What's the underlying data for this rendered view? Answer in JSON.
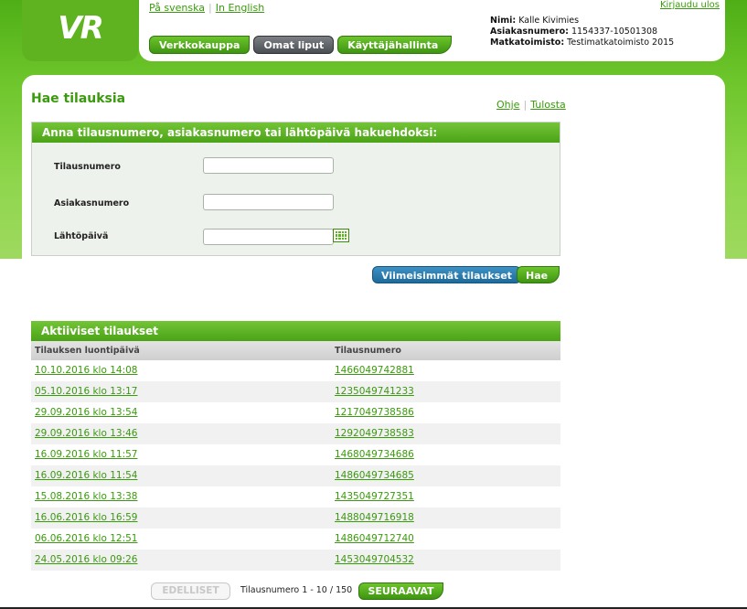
{
  "brand": {
    "logo": "VR",
    "accent": "#4fae16"
  },
  "header": {
    "lang_sv": "På svenska",
    "lang_en": "In English",
    "logout": "Kirjaudu ulos",
    "user": {
      "name_label": "Nimi:",
      "name": "Kalle Kivimies",
      "customer_label": "Asiakasnumero:",
      "customer": "1154337-10501308",
      "office_label": "Matkatoimisto:",
      "office": "Testimatkatoimisto 2015"
    },
    "tabs": [
      {
        "label": "Verkkokauppa"
      },
      {
        "label": "Omat liput"
      },
      {
        "label": "Käyttäjähallinta"
      }
    ]
  },
  "main": {
    "title": "Hae tilauksia",
    "help": "Ohje",
    "print": "Tulosta",
    "search": {
      "header": "Anna tilausnumero, asiakasnumero tai lähtöpäivä hakuehdoksi:",
      "order_label": "Tilausnumero",
      "order_value": "",
      "customer_label": "Asiakasnumero",
      "customer_value": "",
      "date_label": "Lähtöpäivä",
      "date_value": ""
    },
    "recent_button": "Viimeisimmät tilaukset",
    "search_button": "Hae",
    "orders": {
      "header": "Aktiiviset tilaukset",
      "col_created": "Tilauksen luontipäivä",
      "col_number": "Tilausnumero",
      "rows": [
        {
          "date": "10.10.2016 klo 14:08",
          "number": "1466049742881"
        },
        {
          "date": "05.10.2016 klo 13:17",
          "number": "1235049741233"
        },
        {
          "date": "29.09.2016 klo 13:54",
          "number": "1217049738586"
        },
        {
          "date": "29.09.2016 klo 13:46",
          "number": "1292049738583"
        },
        {
          "date": "16.09.2016 klo 11:57",
          "number": "1468049734686"
        },
        {
          "date": "16.09.2016 klo 11:54",
          "number": "1486049734685"
        },
        {
          "date": "15.08.2016 klo 13:38",
          "number": "1435049727351"
        },
        {
          "date": "16.06.2016 klo 16:59",
          "number": "1488049716918"
        },
        {
          "date": "06.06.2016 klo 12:51",
          "number": "1486049712740"
        },
        {
          "date": "24.05.2016 klo 09:26",
          "number": "1453049704532"
        }
      ]
    },
    "pager": {
      "prev": "EDELLISET",
      "info": "Tilausnumero 1 - 10 / 150",
      "next": "SEURAAVAT"
    }
  }
}
